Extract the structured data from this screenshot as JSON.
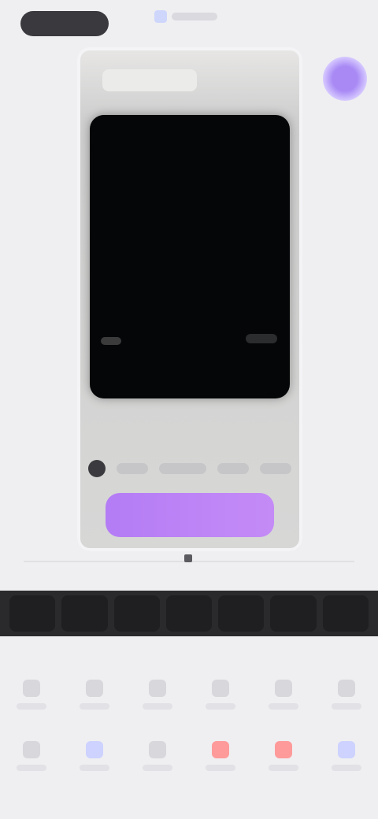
{
  "header": {
    "left_pill_label": "",
    "chip_label": ""
  },
  "phone": {
    "buy_button_label": ""
  },
  "colors": {
    "background": "#efeff1",
    "accent": "#b47cf5",
    "dark_strip": "#2a2a2d"
  },
  "bottom": {
    "row1": [
      "",
      "",
      "",
      "",
      "",
      ""
    ],
    "row2": [
      "",
      "",
      "",
      "",
      "",
      ""
    ]
  },
  "icons": {
    "avatar": "avatar-icon",
    "chip": "app-icon"
  }
}
